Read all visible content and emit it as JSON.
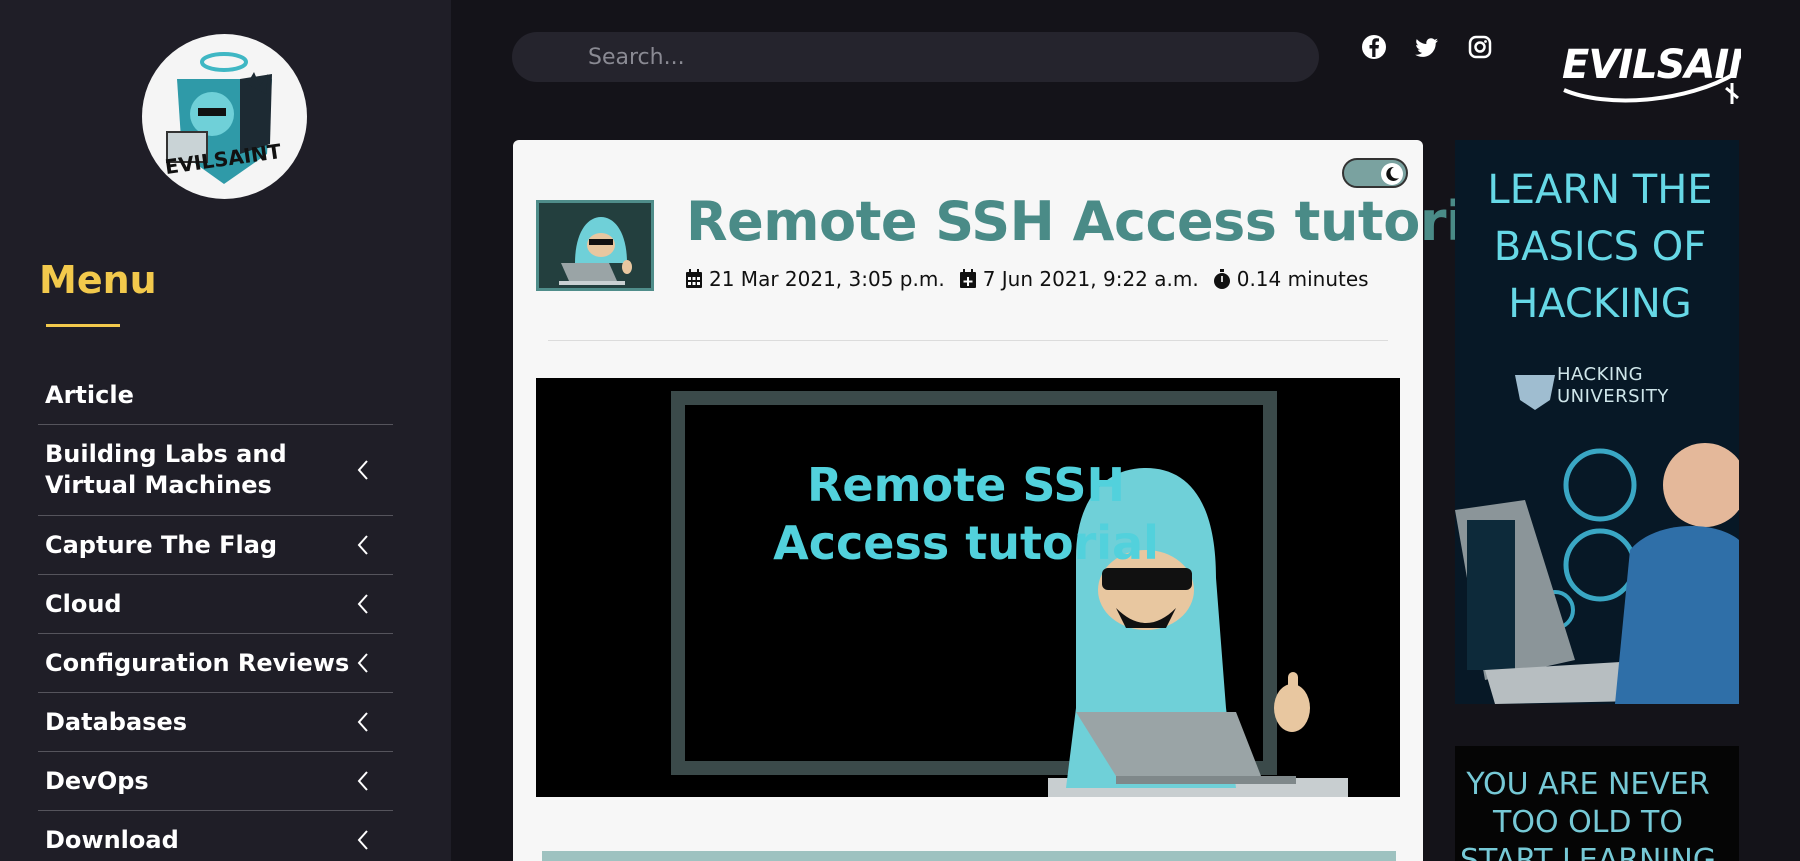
{
  "sidebar": {
    "logo_text": "EVILSAINT",
    "menu_title": "Menu",
    "items": [
      {
        "label": "Article",
        "has_chevron": false
      },
      {
        "label": "Building Labs and Virtual Machines",
        "has_chevron": true
      },
      {
        "label": "Capture The Flag",
        "has_chevron": true
      },
      {
        "label": "Cloud",
        "has_chevron": true
      },
      {
        "label": "Configuration Reviews",
        "has_chevron": true
      },
      {
        "label": "Databases",
        "has_chevron": true
      },
      {
        "label": "DevOps",
        "has_chevron": true
      },
      {
        "label": "Download",
        "has_chevron": true
      }
    ]
  },
  "header": {
    "search_placeholder": "Search...",
    "social": [
      "facebook-icon",
      "twitter-icon",
      "instagram-icon"
    ],
    "brand_text": "EVILSAINT"
  },
  "article": {
    "title": "Remote SSH Access tutorial",
    "published": "21 Mar 2021, 3:05 p.m.",
    "updated": "7 Jun 2021, 9:22 a.m.",
    "read_time": "0.14 minutes",
    "hero_text": "Remote SSH Access tutorial"
  },
  "ads": {
    "ad1_headline": "LEARN THE BASICS OF HACKING",
    "ad1_brand_line1": "HACKING",
    "ad1_brand_line2": "UNIVERSITY",
    "ad2_text": "YOU ARE NEVER TOO OLD TO START LEARNING"
  },
  "colors": {
    "accent_yellow": "#f2c94c",
    "title_teal": "#4a8b87",
    "hero_cyan": "#52d1dc",
    "sidebar_bg": "#1f1e27",
    "page_bg": "#141319"
  }
}
